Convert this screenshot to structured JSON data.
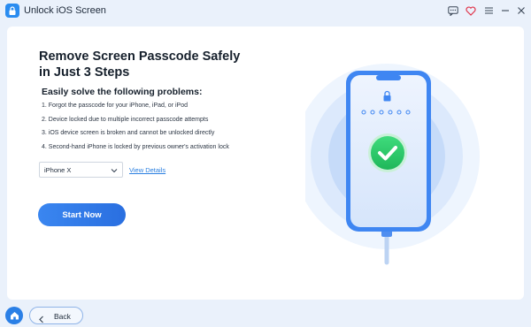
{
  "window": {
    "title": "Unlock iOS Screen",
    "controls": [
      "feedback-icon",
      "heart-icon",
      "menu-icon",
      "minimize-icon",
      "close-icon"
    ]
  },
  "main": {
    "headline": "Remove Screen Passcode Safely in Just 3 Steps",
    "subheading": "Easily solve the following problems:",
    "problems": [
      "1. Forgot the passcode for your iPhone, iPad, or iPod",
      "2. Device locked due to multiple incorrect passcode attempts",
      "3. iOS device screen is broken and cannot be unlocked directly",
      "4. Second-hand iPhone is locked by previous owner's activation lock"
    ],
    "device_select": {
      "value": "iPhone X"
    },
    "view_details": "View Details",
    "start_button": "Start Now"
  },
  "footer": {
    "back_label": "Back"
  },
  "colors": {
    "accent": "#2a7fe6",
    "background": "#eaf1fb",
    "success": "#2ec96a"
  }
}
